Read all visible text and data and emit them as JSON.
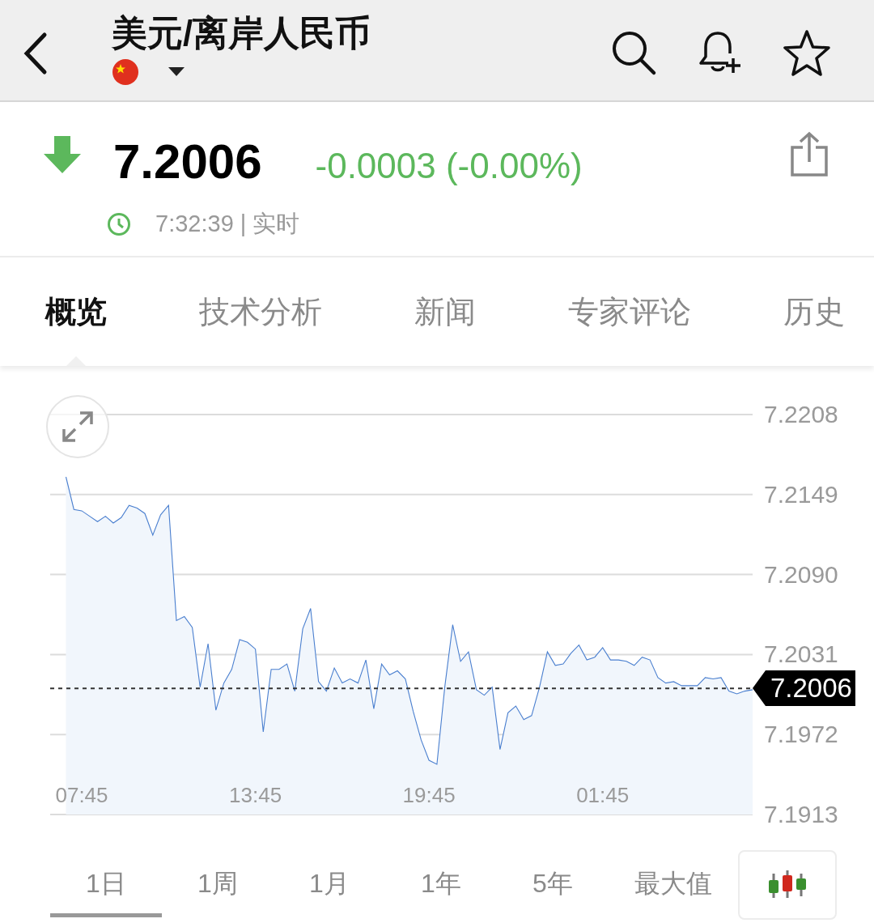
{
  "header": {
    "title": "美元/离岸人民币"
  },
  "quote": {
    "falling": true,
    "price": "7.2006",
    "change": "-0.0003 (-0.00%)",
    "time": "7:32:39 | 实时"
  },
  "tabs": [
    {
      "label": "概览",
      "selected": true
    },
    {
      "label": "技术分析",
      "selected": false
    },
    {
      "label": "新闻",
      "selected": false
    },
    {
      "label": "专家评论",
      "selected": false
    },
    {
      "label": "历史",
      "selected": false
    }
  ],
  "chart": {
    "chart_data": {
      "type": "area",
      "grid": true,
      "ylim": [
        7.1913,
        7.2208
      ],
      "yticks": [
        {
          "value": 7.2208,
          "label": "7.2208"
        },
        {
          "value": 7.2149,
          "label": "7.2149"
        },
        {
          "value": 7.209,
          "label": "7.2090"
        },
        {
          "value": 7.2031,
          "label": "7.2031"
        },
        {
          "value": 7.1972,
          "label": "7.1972"
        },
        {
          "value": 7.1913,
          "label": "7.1913"
        }
      ],
      "categories": [
        null,
        null,
        null,
        null,
        "07:45",
        null,
        null,
        null,
        null,
        null,
        null,
        null,
        null,
        null,
        null,
        null,
        null,
        null,
        null,
        null,
        null,
        null,
        null,
        null,
        null,
        null,
        "13:45",
        null,
        null,
        null,
        null,
        null,
        null,
        null,
        null,
        null,
        null,
        null,
        null,
        null,
        null,
        null,
        null,
        null,
        null,
        null,
        null,
        null,
        "19:45",
        null,
        null,
        null,
        null,
        null,
        null,
        null,
        null,
        null,
        null,
        null,
        null,
        null,
        null,
        null,
        null,
        null,
        null,
        null,
        null,
        null,
        "01:45",
        null,
        null,
        null,
        null,
        null,
        null,
        null,
        null,
        null,
        null,
        null,
        null,
        null,
        null,
        null,
        null,
        null,
        null,
        null
      ],
      "series": [
        {
          "color": "#4a7fcf",
          "values": [
            null,
            null,
            7.2162,
            7.2138,
            7.2137,
            7.2133,
            7.2129,
            7.2133,
            7.2128,
            7.2132,
            7.2141,
            7.2139,
            7.2135,
            7.2119,
            7.2134,
            7.2141,
            7.2056,
            7.2059,
            7.2051,
            7.2007,
            7.2039,
            7.199,
            7.201,
            7.202,
            7.2042,
            7.204,
            7.2035,
            7.1974,
            7.202,
            7.202,
            7.2024,
            7.2004,
            7.205,
            7.2065,
            7.2011,
            7.2004,
            7.2021,
            7.201,
            7.2013,
            7.201,
            7.2027,
            7.1991,
            7.2024,
            7.2016,
            7.2019,
            7.2013,
            7.1989,
            7.1968,
            7.1953,
            7.195,
            7.2007,
            7.2053,
            7.2026,
            7.2033,
            7.2005,
            7.2001,
            7.2007,
            7.1961,
            7.1988,
            7.1993,
            7.1983,
            7.1986,
            7.2007,
            7.2033,
            7.2023,
            7.2024,
            7.2032,
            7.2038,
            7.2027,
            7.2029,
            7.2036,
            7.2027,
            7.2027,
            7.2026,
            7.2023,
            7.2029,
            7.2027,
            7.2014,
            7.201,
            7.2011,
            7.2008,
            7.2008,
            7.2008,
            7.2014,
            7.2013,
            7.2014,
            7.2004,
            7.2002,
            7.2004,
            7.2005
          ]
        }
      ],
      "ref_lines": [
        {
          "axis": "y",
          "value": 7.2006,
          "label": "7.2006"
        }
      ]
    }
  },
  "ranges": [
    {
      "label": "1日",
      "selected": true
    },
    {
      "label": "1周",
      "selected": false
    },
    {
      "label": "1月",
      "selected": false
    },
    {
      "label": "1年",
      "selected": false
    },
    {
      "label": "5年",
      "selected": false
    },
    {
      "label": "最大值",
      "selected": false
    }
  ]
}
